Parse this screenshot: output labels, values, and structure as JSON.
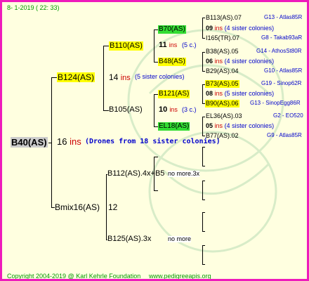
{
  "header": {
    "date": "8-  1-2019 (  22:  33)"
  },
  "footer": {
    "copyright": "Copyright 2004-2019 @ Karl Kehrle Foundation",
    "website": "www.pedigreeapis.org"
  },
  "root": {
    "name": "B40(AS)",
    "count": "16",
    "ins": "ins",
    "note": "(Drones from 18 sister colonies)"
  },
  "gen1": {
    "mother": {
      "name": "B124(AS)",
      "count": "14",
      "ins": "ins",
      "note": "(5 sister colonies)"
    },
    "father": {
      "name": "Bmix16(AS)",
      "count": "12"
    }
  },
  "gen2": {
    "b110": {
      "name": "B110(AS)"
    },
    "b105": {
      "name": "B105(AS)"
    },
    "b112": {
      "name": "B112(AS).4x+B5",
      "extra": "no more.3x"
    },
    "b125": {
      "name": "B125(AS).3x",
      "extra": "no more"
    }
  },
  "gen3": {
    "b70": {
      "name": "B70(AS)",
      "count": "11",
      "ins": "ins",
      "note": "(5 c.)"
    },
    "b48": {
      "name": "B48(AS)"
    },
    "b121": {
      "name": "B121(AS)",
      "count": "10",
      "ins": "ins",
      "note": "(3 c.)"
    },
    "el18": {
      "name": "EL18(AS)"
    }
  },
  "gen4": [
    {
      "name": "B113(AS).07",
      "code": "G13 - Atlas85R"
    },
    {
      "count": "09",
      "ins": "ins",
      "note": "(4 sister colonies)"
    },
    {
      "name": "I165(TR).07",
      "code": "G8 - Takab93aR"
    },
    {
      "name": "B38(AS).05",
      "code": "G14 - AthosSt80R"
    },
    {
      "count": "06",
      "ins": "ins",
      "note": "(4 sister colonies)"
    },
    {
      "name": "B29(AS).04",
      "code": "G10 - Atlas85R"
    },
    {
      "name": "B73(AS).05",
      "code": "G19 - Sinop62R"
    },
    {
      "count": "08",
      "ins": "ins",
      "note": "(5 sister colonies)"
    },
    {
      "name": "B90(AS).06",
      "code": "G13 - SinopEgg86R"
    },
    {
      "name": "EL36(AS).03",
      "code": "G2 - EO520"
    },
    {
      "count": "05",
      "ins": "ins",
      "note": "(4 sister colonies)"
    },
    {
      "name": "B77(AS).02",
      "code": "G9 - Atlas85R"
    }
  ],
  "colors": {
    "border": "#ee1bbb",
    "background": "#ffffe0",
    "highlight": "#ffff00",
    "highlight_green": "#33dd33",
    "ins": "#cc0000",
    "note": "#0000cc",
    "footer": "#009900"
  }
}
